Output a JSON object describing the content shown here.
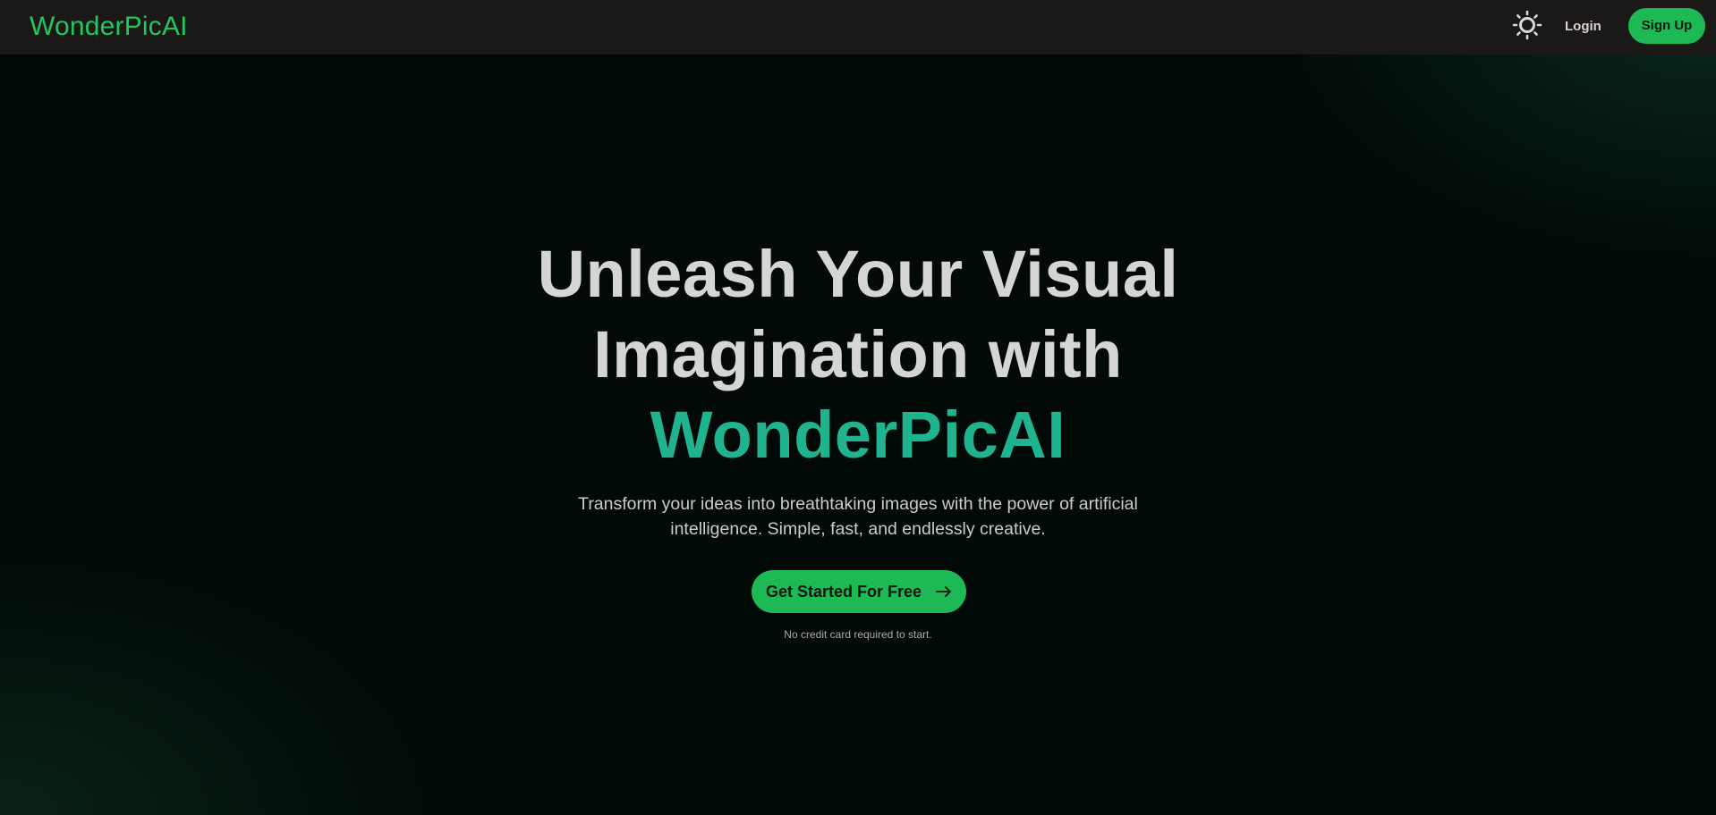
{
  "header": {
    "brand": "WonderPicAI",
    "theme_toggle_icon": "sun-icon",
    "login_label": "Login",
    "signup_label": "Sign Up"
  },
  "hero": {
    "headline_line1": "Unleash Your Visual",
    "headline_line2": "Imagination with",
    "headline_brand": "WonderPicAI",
    "subtitle": "Transform your ideas into breathtaking images with the power of artificial intelligence. Simple, fast, and endlessly creative.",
    "cta_label": "Get Started For Free",
    "cta_icon": "arrow-right-icon",
    "note": "No credit card required to start."
  },
  "colors": {
    "accent": "#22c55e",
    "brand_gradient": "#1fb38f",
    "topbar": "#1b1818",
    "background": "#020a07"
  }
}
